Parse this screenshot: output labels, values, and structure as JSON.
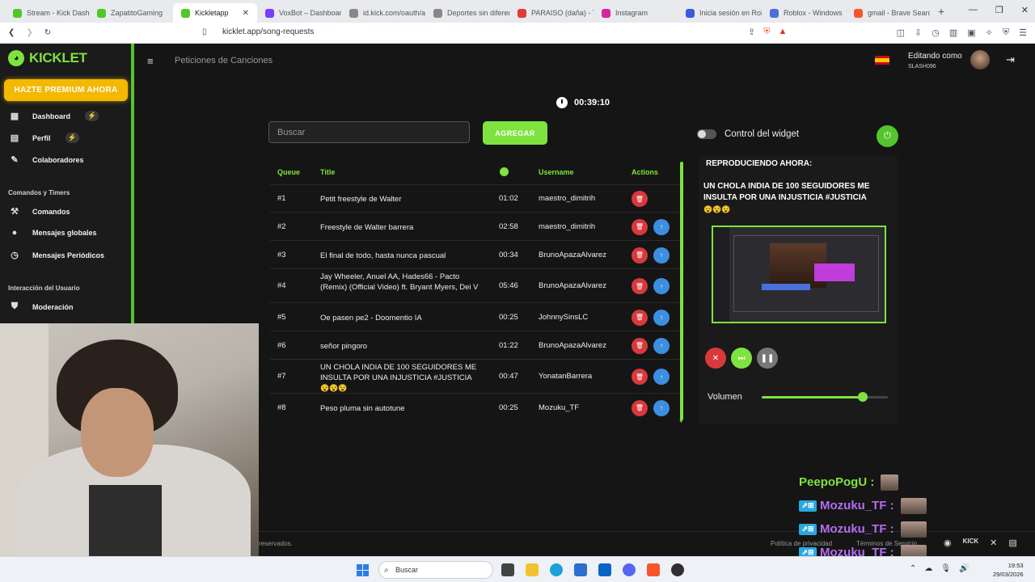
{
  "browser": {
    "tabs": [
      {
        "label": "Stream - Kick Dashb",
        "color": "#53c62b"
      },
      {
        "label": "ZapatitoGaming",
        "color": "#53c62b"
      },
      {
        "label": "Kickletapp",
        "color": "#53c62b",
        "active": true
      },
      {
        "label": "VoxBot – Dashboar",
        "color": "#7a3cff"
      },
      {
        "label": "id.kick.com/oauth/a",
        "color": "#888888"
      },
      {
        "label": "Deportes sin diferen",
        "color": "#888888"
      },
      {
        "label": "PARAISO (daña) - Yo",
        "color": "#e53935"
      },
      {
        "label": "Instagram",
        "color": "#d6249f"
      },
      {
        "label": "Inicia sesión en Rob",
        "color": "#3b5bdb"
      },
      {
        "label": "Roblox - Windows",
        "color": "#4a6fd8"
      },
      {
        "label": "gmail - Brave Searc",
        "color": "#fb542b"
      }
    ],
    "url": "kicklet.app/song-requests"
  },
  "sidebar": {
    "logo": "KICKLET",
    "premium_button": "HAZTE PREMIUM AHORA",
    "items": [
      {
        "label": "Dashboard",
        "icon": "dashboard-icon",
        "glyph": "▦",
        "bolt": true
      },
      {
        "label": "Perfil",
        "icon": "profile-icon",
        "glyph": "▤",
        "bolt": true
      },
      {
        "label": "Colaboradores",
        "icon": "collaborators-icon",
        "glyph": "✎",
        "bolt": false
      }
    ],
    "section_commands": "Comandos y Timers",
    "command_items": [
      {
        "label": "Comandos",
        "icon": "command-icon",
        "glyph": "⚒"
      },
      {
        "label": "Mensajes globales",
        "icon": "chat-bubble-icon",
        "glyph": "●"
      },
      {
        "label": "Mensajes Periódicos",
        "icon": "clock-icon",
        "glyph": "◷"
      }
    ],
    "section_interaction": "Interacción del Usuario",
    "interaction_items": [
      {
        "label": "Moderación",
        "icon": "shield-icon",
        "glyph": "⛊"
      }
    ]
  },
  "header": {
    "page_title": "Peticiones de Canciones",
    "editing_label": "Editando como",
    "username": "SLASH096"
  },
  "queue": {
    "timer": "00:39:10",
    "search_placeholder": "Buscar",
    "add_button": "AGREGAR",
    "columns": {
      "queue": "Queue",
      "title": "Title",
      "username": "Username",
      "actions": "Actions"
    },
    "rows": [
      {
        "num": "#1",
        "title": "Petit freestyle de Walter",
        "duration": "01:02",
        "user": "maestro_dimitrih",
        "up": false
      },
      {
        "num": "#2",
        "title": "Freestyle de Walter barrera",
        "duration": "02:58",
        "user": "maestro_dimitrih",
        "up": true
      },
      {
        "num": "#3",
        "title": "El final de todo, hasta nunca pascual",
        "duration": "00:34",
        "user": "BrunoApazaAlvarez",
        "up": true
      },
      {
        "num": "#4",
        "title": "Jay Wheeler, Anuel AA, Hades66 - Pacto (Remix) (Official Video) ft. Bryant Myers, Dei V",
        "duration": "05:46",
        "user": "BrunoApazaAlvarez",
        "up": true
      },
      {
        "num": "#5",
        "title": "Oe pasen pe2 - Doomentio IA",
        "duration": "00:25",
        "user": "JohnnySinsLC",
        "up": true
      },
      {
        "num": "#6",
        "title": "señor pingoro",
        "duration": "01:22",
        "user": "BrunoApazaAlvarez",
        "up": true
      },
      {
        "num": "#7",
        "title": "UN CHOLA INDIA DE 100 SEGUIDORES ME INSULTA POR UNA INJUSTICIA #JUSTICIA",
        "emoji": "😵😵😵",
        "duration": "00:47",
        "user": "YonatanBarrera",
        "up": true
      },
      {
        "num": "#8",
        "title": "Peso pluma sin autotune",
        "duration": "00:25",
        "user": "Mozuku_TF",
        "up": true
      }
    ]
  },
  "player": {
    "widget_control": "Control del widget",
    "now_playing_label": "REPRODUCIENDO AHORA:",
    "now_playing_title": "UN CHOLA INDIA DE 100 SEGUIDORES ME INSULTA POR UNA INJUSTICIA #JUSTICIA",
    "now_playing_emoji": "😵😵😵",
    "volume_label": "Volumen",
    "volume_level": 0.8
  },
  "footer": {
    "copyright": "reservados.",
    "privacy": "Política de privacidad",
    "terms": "Términos de Servicio"
  },
  "chat": [
    {
      "name": "PeepoPogU :",
      "color": "#7ee33f",
      "badge": false
    },
    {
      "name": "Mozuku_TF :",
      "color": "#b46cf0",
      "badge": true
    },
    {
      "name": "Mozuku_TF :",
      "color": "#b46cf0",
      "badge": true
    },
    {
      "name": "Mozuku_TF :",
      "color": "#b46cf0",
      "badge": true
    }
  ],
  "taskbar": {
    "search": "Buscar",
    "time": "19:53",
    "date": "29/03/2026"
  }
}
